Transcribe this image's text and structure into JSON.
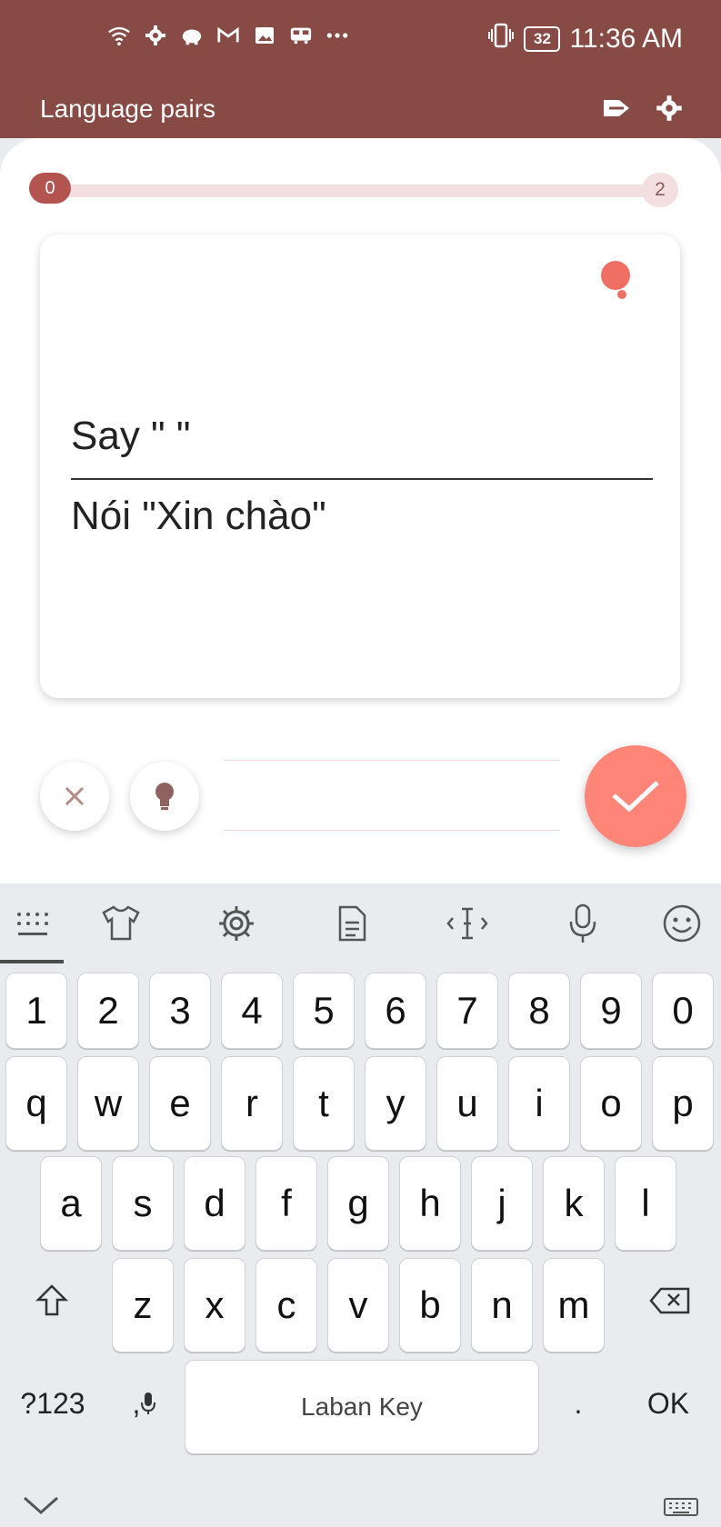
{
  "status_bar": {
    "time": "11:36 AM",
    "battery": "32",
    "icons": [
      "wifi-icon",
      "settings-icon",
      "piggy-bank-icon",
      "gmail-icon",
      "gallery-icon",
      "bus-icon",
      "more-icon",
      "vibrate-icon",
      "battery-icon"
    ]
  },
  "app_bar": {
    "title": "Language pairs",
    "actions": [
      "exit-icon",
      "settings-icon"
    ]
  },
  "progress": {
    "current": "0",
    "total": "2",
    "fraction": 0
  },
  "card": {
    "prompt": "Say \"          \"",
    "translation": "Nói \"Xin chào\""
  },
  "answer": {
    "value": "",
    "placeholder": ""
  },
  "keyboard": {
    "toolbar": [
      "keyboard-icon",
      "shirt-icon",
      "settings-icon",
      "document-icon",
      "cursor-icon",
      "microphone-icon",
      "emoji-icon"
    ],
    "row_numbers": [
      "1",
      "2",
      "3",
      "4",
      "5",
      "6",
      "7",
      "8",
      "9",
      "0"
    ],
    "row_1": [
      "q",
      "w",
      "e",
      "r",
      "t",
      "y",
      "u",
      "i",
      "o",
      "p"
    ],
    "row_2": [
      "a",
      "s",
      "d",
      "f",
      "g",
      "h",
      "j",
      "k",
      "l"
    ],
    "row_3": [
      "z",
      "x",
      "c",
      "v",
      "b",
      "n",
      "m"
    ],
    "bottom": {
      "symbols": "?123",
      "comma": ",",
      "space": "Laban Key",
      "period": ".",
      "ok": "OK"
    }
  },
  "colors": {
    "app_bar": "#874a45",
    "accent": "#ef6f64",
    "submit": "#ff8579",
    "progress_track": "#f3dfdf"
  }
}
